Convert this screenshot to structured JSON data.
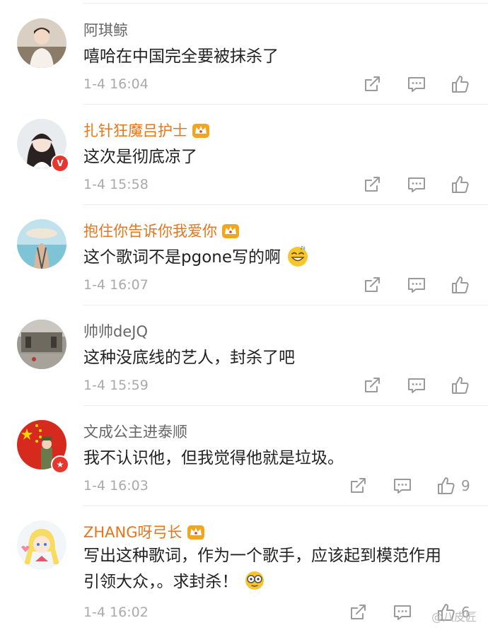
{
  "comments": [
    {
      "username": "阿琪鲸",
      "text": "嘻哈在中国完全要被抹杀了",
      "time": "1-4 16:04",
      "likes": ""
    },
    {
      "username": "扎针狂魔吕护士",
      "text": "这次是彻底凉了",
      "time": "1-4 15:58",
      "likes": "",
      "verified_badge": "V"
    },
    {
      "username": "抱住你告诉你我爱你",
      "text": "这个歌词不是pgone写的啊",
      "time": "1-4 16:07",
      "likes": ""
    },
    {
      "username": "帅帅deJQ",
      "text": "这种没底线的艺人，封杀了吧",
      "time": "1-4 15:59",
      "likes": ""
    },
    {
      "username": "文成公主进泰顺",
      "text": "我不认识他，但我觉得他就是垃圾。",
      "time": "1-4 16:03",
      "likes": "9"
    },
    {
      "username": "ZHANG呀弓长",
      "text_line1": "写出这种歌词，作为一个歌手，应该起到模范作用",
      "text_line2": "引领大众，。求封杀！",
      "time": "1-4 16:02",
      "likes": "6"
    }
  ],
  "watermark": "@八皮匠",
  "icons": {
    "repost": "repost-icon",
    "comment": "comment-icon",
    "like": "like-icon",
    "crown": "crown-vip-icon",
    "emoji_sweat": "sweat-smile-emoji-icon",
    "emoji_glasses": "glasses-emoji-icon"
  },
  "colors": {
    "username": "#666666",
    "vip_username": "#e8751a",
    "text": "#222222",
    "meta": "#aaaaaa",
    "icon": "#999999"
  }
}
